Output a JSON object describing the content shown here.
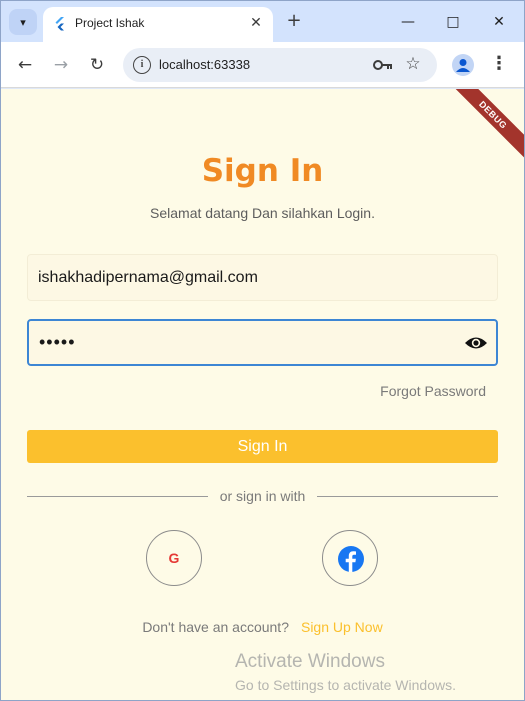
{
  "browser": {
    "tab_title": "Project Ishak",
    "url": "localhost:63338",
    "close_tab_glyph": "✕",
    "new_tab_glyph": "+",
    "minimize_glyph": "—",
    "maximize_glyph": "□",
    "close_window_glyph": "✕",
    "back_glyph": "←",
    "forward_glyph": "→",
    "reload_glyph": "↻",
    "info_glyph": "i",
    "star_glyph": "☆",
    "menu_glyph": "⋮",
    "tab_search_glyph": "▾",
    "colors": {
      "tabstrip": "#d3e3fd",
      "omnibox": "#e9eef6"
    }
  },
  "debug_banner": "DEBUG",
  "signin": {
    "title": "Sign In",
    "subtitle": "Selamat datang Dan silahkan Login.",
    "email_value": "ishakhadipernama@gmail.com",
    "password_value": "•••••",
    "forgot_password": "Forgot Password",
    "button_label": "Sign In",
    "divider_text": "or sign in with",
    "google_label": "G",
    "no_account": "Don't have an account?",
    "signup_link": "Sign Up Now",
    "colors": {
      "background": "#fefbe7",
      "title": "#f08a24",
      "button": "#fbc02d",
      "link": "#fbc02d",
      "focus_border": "#3d86d4",
      "facebook": "#1877f2",
      "google": "#e53935"
    },
    "icons": [
      "eye-icon",
      "google-icon",
      "facebook-icon"
    ]
  },
  "watermark": {
    "title": "Activate Windows",
    "subtitle": "Go to Settings to activate Windows."
  }
}
